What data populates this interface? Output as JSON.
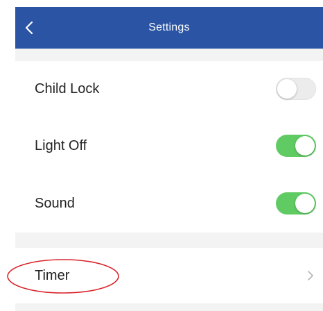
{
  "header": {
    "title": "Settings",
    "back_icon": "chevron-left-icon",
    "background": "#2b55a4"
  },
  "settings": {
    "child_lock": {
      "label": "Child Lock",
      "enabled": false
    },
    "light_off": {
      "label": "Light Off",
      "enabled": true
    },
    "sound": {
      "label": "Sound",
      "enabled": true
    }
  },
  "timer": {
    "label": "Timer",
    "chevron_icon": "chevron-right-icon"
  },
  "colors": {
    "toggle_on": "#5fcb62",
    "toggle_off": "#ececec",
    "section_gap": "#f3f3f3",
    "annotation": "#d9232a"
  }
}
